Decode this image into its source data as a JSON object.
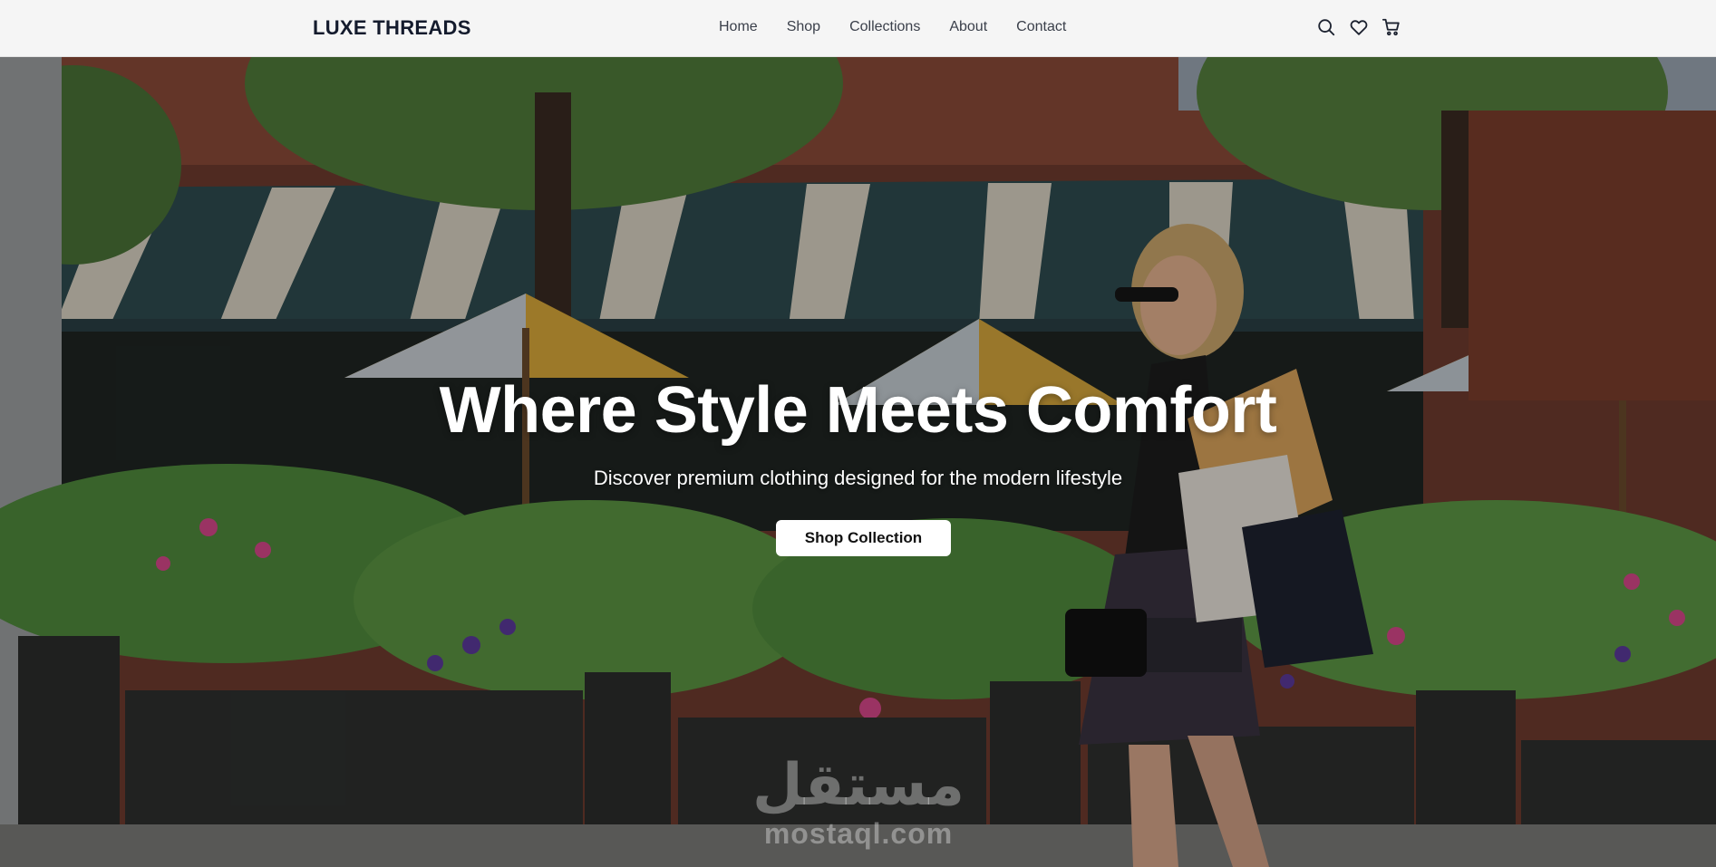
{
  "brand": "LUXE THREADS",
  "nav": [
    "Home",
    "Shop",
    "Collections",
    "About",
    "Contact"
  ],
  "header_icons": [
    "search-icon",
    "heart-icon",
    "cart-icon"
  ],
  "hero": {
    "title": "Where Style Meets Comfort",
    "subtitle": "Discover premium clothing designed for the modern lifestyle",
    "cta_label": "Shop Collection"
  },
  "watermark": {
    "arabic": "مستقل",
    "latin": "mostaql.com"
  },
  "colors": {
    "header_bg": "#f5f5f5",
    "brand_text": "#141b2d",
    "nav_text": "#3a3f4a",
    "hero_text": "#ffffff",
    "cta_bg": "#ffffff"
  }
}
